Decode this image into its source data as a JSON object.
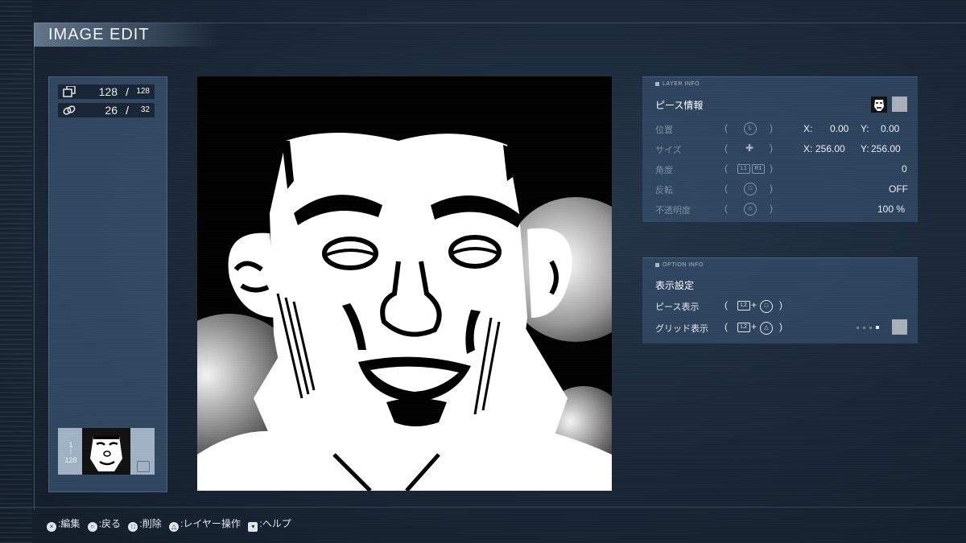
{
  "title": "IMAGE EDIT",
  "counters": [
    {
      "icon": "layers-icon",
      "value": "128",
      "max": "128"
    },
    {
      "icon": "link-icon",
      "value": "26",
      "max": "32"
    }
  ],
  "thumbnail": {
    "index": "1",
    "total": "128"
  },
  "layer_info": {
    "header": "LAYER INFO",
    "section": "ピース情報",
    "rows": [
      {
        "label": "位置",
        "button": "L",
        "x": "0.00",
        "y": "0.00"
      },
      {
        "label": "サイズ",
        "button": "✚",
        "x": "256.00",
        "y": "256.00"
      },
      {
        "label": "角度",
        "button_l": "L1",
        "button_r": "R1",
        "value": "0"
      },
      {
        "label": "反転",
        "button": "□",
        "value": "OFF"
      },
      {
        "label": "不透明度",
        "button": "◇",
        "value": "100 %"
      }
    ],
    "x_label": "X:",
    "y_label": "Y:"
  },
  "option_info": {
    "header": "OPTION INFO",
    "section": "表示設定",
    "rows": [
      {
        "label": "ピース表示",
        "button": "□"
      },
      {
        "label": "グリッド表示",
        "button": "△"
      }
    ]
  },
  "footer": [
    {
      "icon": "×",
      "label": ":編集"
    },
    {
      "icon": "○",
      "label": ":戻る"
    },
    {
      "icon": "□",
      "label": ":削除"
    },
    {
      "icon": "△",
      "label": ":レイヤー操作"
    },
    {
      "icon": "▾",
      "label": ":ヘルプ"
    }
  ],
  "paren_open": "(",
  "paren_close": ")",
  "slash": "/",
  "plus": "+",
  "l2": "L2"
}
